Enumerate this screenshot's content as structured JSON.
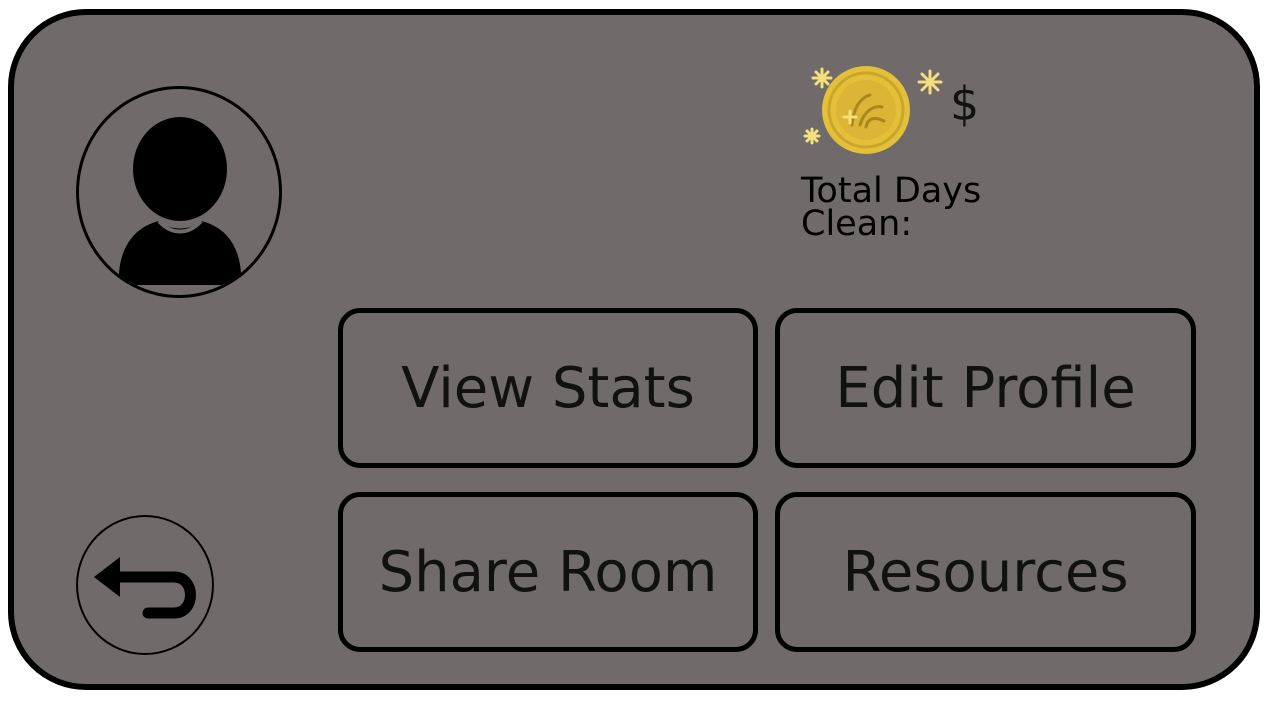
{
  "stats": {
    "currency_symbol": "$",
    "days_line1": "Total Days",
    "days_line2": "Clean:"
  },
  "buttons": {
    "view_stats": "View Stats",
    "edit_profile": "Edit Profile",
    "share_room": "Share Room",
    "resources": "Resources"
  },
  "icons": {
    "avatar": "user-silhouette-icon",
    "coin": "sparkling-gold-coin-icon",
    "back": "back-arrow-icon"
  },
  "colors": {
    "panel_background": "#706a6a",
    "border": "#000000",
    "coin_gold": "#e3bf3a",
    "sparkle": "#f3df7c"
  }
}
